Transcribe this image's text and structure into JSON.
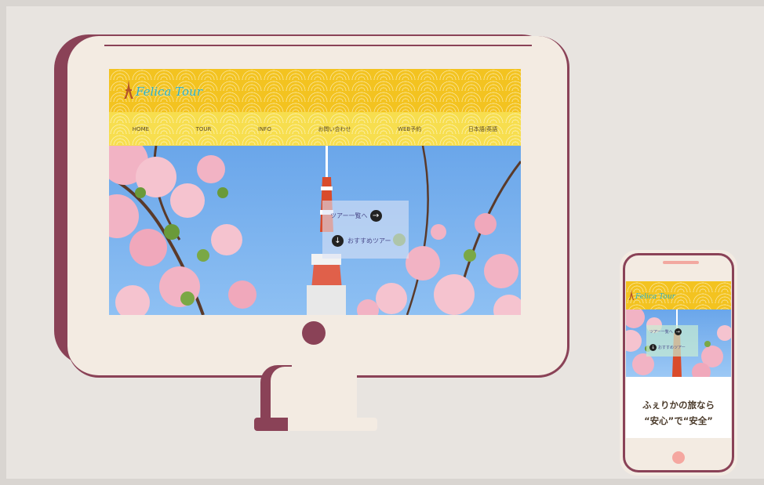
{
  "desktop": {
    "logo_text": "Felica Tour",
    "nav": [
      {
        "label": "HOME"
      },
      {
        "label": "TOUR"
      },
      {
        "label": "INFO"
      },
      {
        "label": "お問い合わせ"
      },
      {
        "label": "WEB予約"
      },
      {
        "label": "日本語/英語"
      }
    ],
    "hero": {
      "tour_list_link": "ツアー一覧へ",
      "recommended_link": "おすすめツアー"
    }
  },
  "mobile": {
    "logo_text": "Felica Tour",
    "hero": {
      "tour_list_link": "ツアー一覧へ",
      "recommended_link": "おすすめツアー"
    },
    "tagline_line1": "ふぇりかの旅なら",
    "tagline_line2": "“安心”で“安全”"
  },
  "icons": {
    "tour_list_icon": "arrow-right-circle-icon",
    "recommended_icon": "arrow-down-circle-icon",
    "logo_icon": "tokyo-tower-icon"
  },
  "colors": {
    "frame": "#8a4257",
    "device_body": "#f3ebe2",
    "header_yellow": "#f3c320",
    "nav_yellow": "#f7de4e",
    "logo_teal": "#2ab0c8",
    "sky_blue": "#6aa6ea",
    "sakura_pink": "#f2b3c4"
  }
}
